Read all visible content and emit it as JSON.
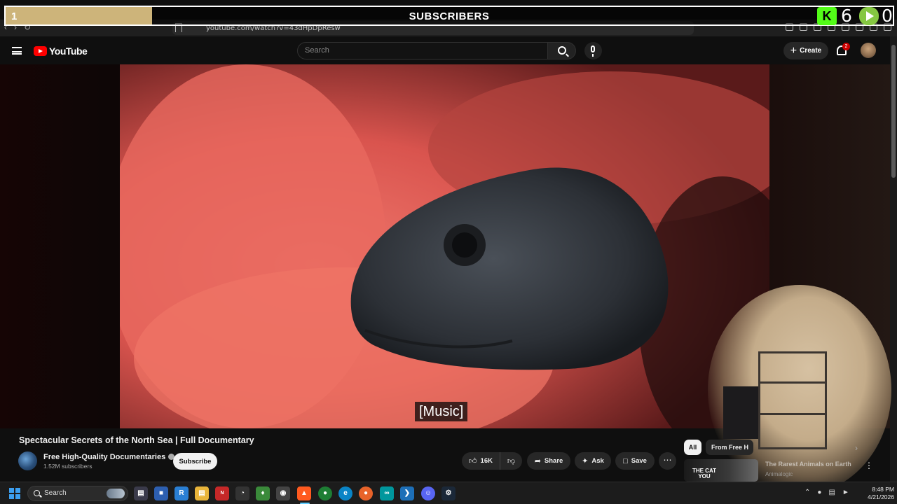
{
  "stream_overlay": {
    "goal_count": "1",
    "goal_label": "SUBSCRIBERS",
    "goal_progress": 0.165,
    "kick_count": "6",
    "rumble_count": "0",
    "colors": {
      "goal_fill": "#cdb47a",
      "kick": "#53fc18",
      "rumble": "#85c742"
    }
  },
  "browser": {
    "url": "youtube.com/watch?v=43dHpDpResw"
  },
  "youtube": {
    "logo_text": "YouTube",
    "search_placeholder": "Search",
    "create_label": "Create",
    "notification_count": "2",
    "accent_color": "#ff0000"
  },
  "video": {
    "caption": "[Music]",
    "title": "Spectacular Secrets of the North Sea | Full Documentary",
    "channel_name": "Free High-Quality Documentaries",
    "subscriber_count": "1.52M subscribers",
    "subscribe_label": "Subscribe",
    "like_count": "16K",
    "share_label": "Share",
    "ask_label": "Ask",
    "save_label": "Save"
  },
  "sidebar": {
    "chips": [
      "All",
      "From Free H"
    ],
    "recommendation": {
      "thumb_text": "THE CAT YOU",
      "title": "The Rarest Animals on Earth",
      "channel": "Animalogic"
    }
  },
  "taskbar": {
    "search_label": "Search",
    "time": "8:48 PM",
    "date": "4/21/2026"
  }
}
